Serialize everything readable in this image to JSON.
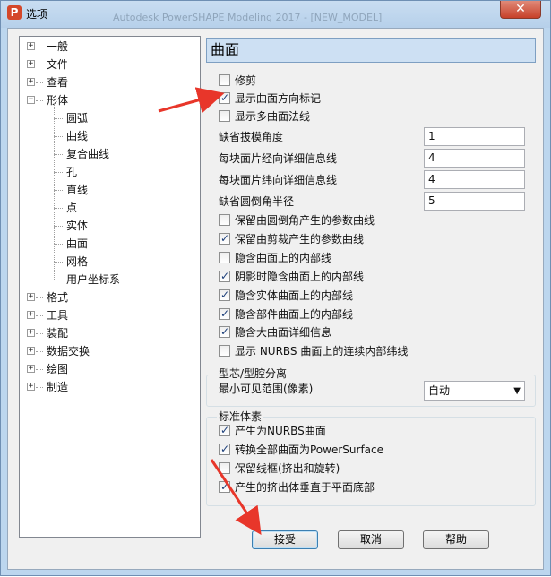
{
  "window": {
    "title": "选项",
    "background_title": "Autodesk PowerSHAPE Modeling 2017 - [NEW_MODEL]",
    "close_glyph": "✕"
  },
  "tree": {
    "items": [
      {
        "label": "一般",
        "expander": "+"
      },
      {
        "label": "文件",
        "expander": "+"
      },
      {
        "label": "查看",
        "expander": "+"
      },
      {
        "label": "形体",
        "expander": "−"
      },
      {
        "label": "圆弧"
      },
      {
        "label": "曲线"
      },
      {
        "label": "复合曲线"
      },
      {
        "label": "孔"
      },
      {
        "label": "直线"
      },
      {
        "label": "点"
      },
      {
        "label": "实体"
      },
      {
        "label": "曲面"
      },
      {
        "label": "网格"
      },
      {
        "label": "用户坐标系"
      },
      {
        "label": "格式",
        "expander": "+"
      },
      {
        "label": "工具",
        "expander": "+"
      },
      {
        "label": "装配",
        "expander": "+"
      },
      {
        "label": "数据交换",
        "expander": "+"
      },
      {
        "label": "绘图",
        "expander": "+"
      },
      {
        "label": "制造",
        "expander": "+"
      }
    ]
  },
  "panel": {
    "title": "曲面",
    "options_top": [
      {
        "label": "修剪",
        "checked": false
      },
      {
        "label": "显示曲面方向标记",
        "checked": true
      },
      {
        "label": "显示多曲面法线",
        "checked": false
      }
    ],
    "fields": [
      {
        "label": "缺省拔模角度",
        "value": "1"
      },
      {
        "label": "每块面片经向详细信息线",
        "value": "4"
      },
      {
        "label": "每块面片纬向详细信息线",
        "value": "4"
      },
      {
        "label": "缺省圆倒角半径",
        "value": "5"
      }
    ],
    "options_bottom": [
      {
        "label": "保留由圆倒角产生的参数曲线",
        "checked": false
      },
      {
        "label": "保留由剪裁产生的参数曲线",
        "checked": true
      },
      {
        "label": "隐含曲面上的内部线",
        "checked": false
      },
      {
        "label": "阴影时隐含曲面上的内部线",
        "checked": true
      },
      {
        "label": "隐含实体曲面上的内部线",
        "checked": true
      },
      {
        "label": "隐含部件曲面上的内部线",
        "checked": true
      },
      {
        "label": "隐含大曲面详细信息",
        "checked": true
      },
      {
        "label": "显示 NURBS 曲面上的连续内部纬线",
        "checked": false
      }
    ],
    "core_cavity": {
      "title": "型芯/型腔分离",
      "label": "最小可见范围(像素)",
      "selected": "自动"
    },
    "standard_primitives": {
      "title": "标准体素",
      "options": [
        {
          "label": "产生为NURBS曲面",
          "checked": true
        },
        {
          "label": "转换全部曲面为PowerSurface",
          "checked": true
        },
        {
          "label": "保留线框(挤出和旋转)",
          "checked": false
        },
        {
          "label": "产生的挤出体垂直于平面底部",
          "checked": true
        }
      ]
    }
  },
  "buttons": {
    "accept": "接受",
    "cancel": "取消",
    "help": "帮助"
  },
  "annotation_color": "#e8362a"
}
